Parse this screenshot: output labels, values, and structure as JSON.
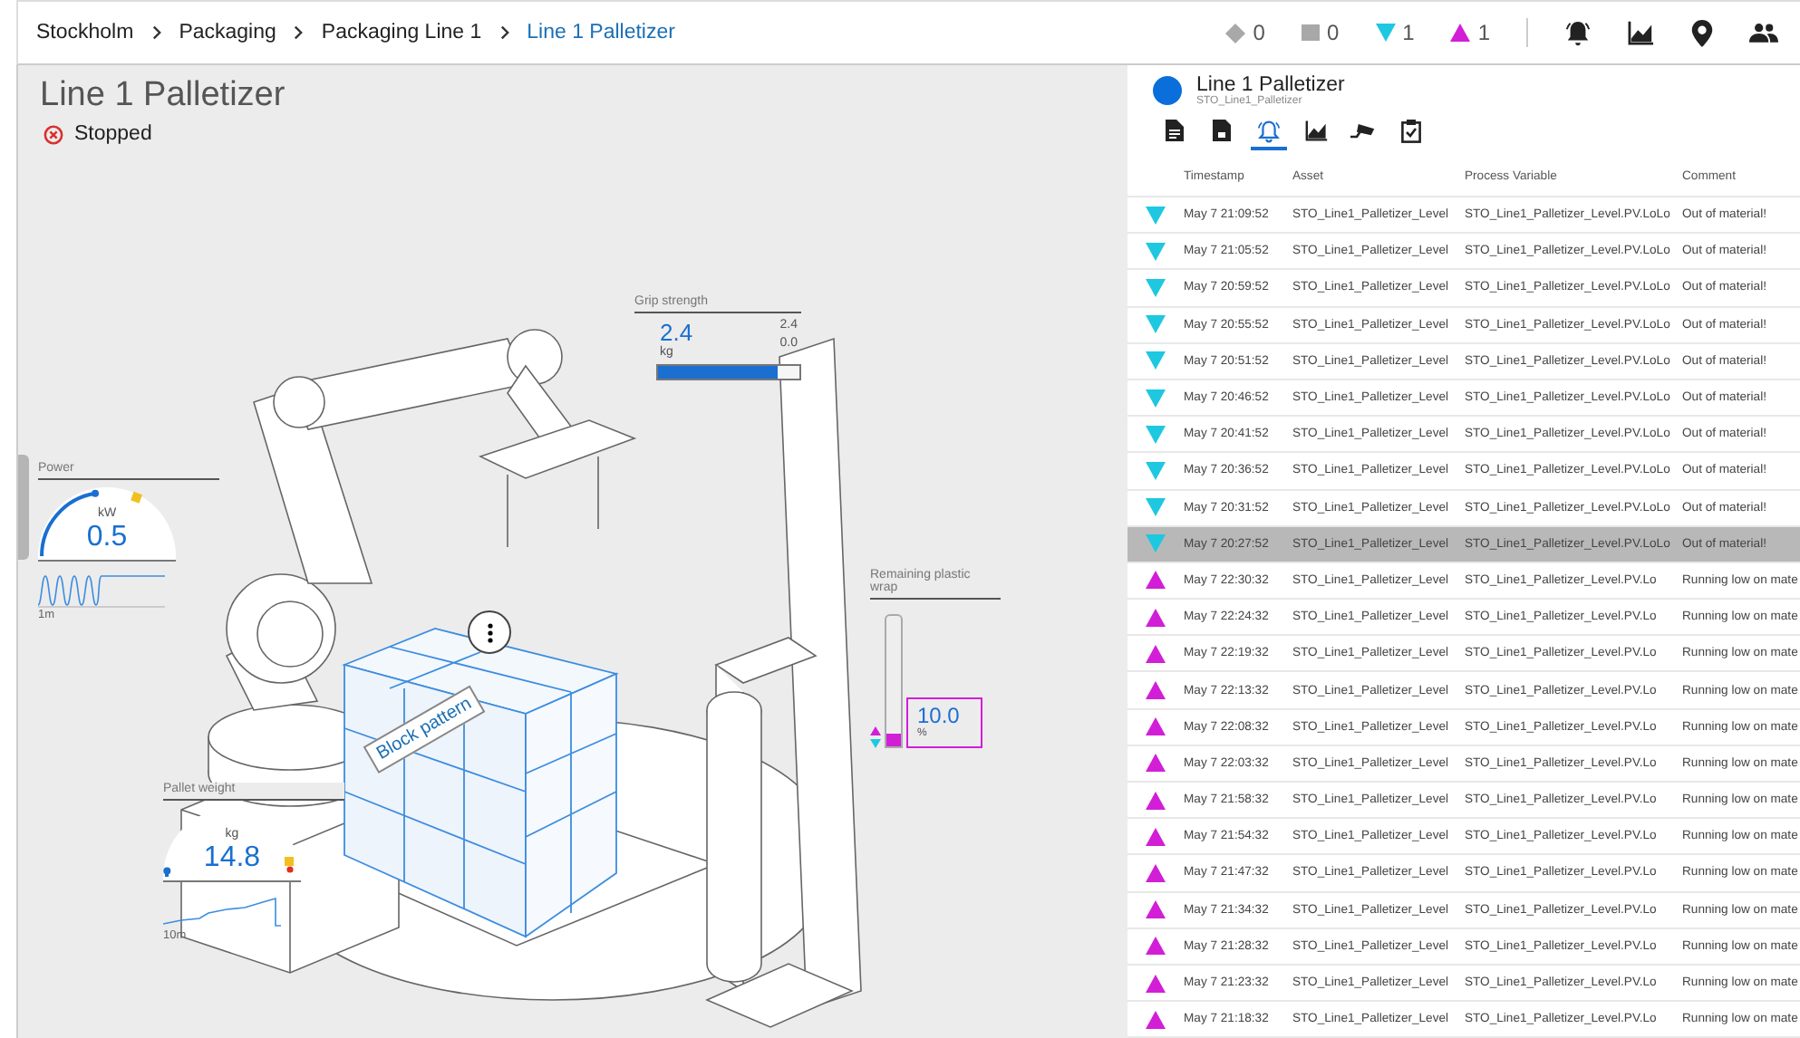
{
  "breadcrumb": [
    {
      "label": "Stockholm",
      "selected": false
    },
    {
      "label": "Packaging",
      "selected": false
    },
    {
      "label": "Packaging Line 1",
      "selected": false
    },
    {
      "label": "Line 1 Palletizer",
      "selected": true
    }
  ],
  "alarm_counts": [
    {
      "kind": "diamond",
      "count": "0"
    },
    {
      "kind": "square",
      "count": "0"
    },
    {
      "kind": "lolo",
      "count": "1"
    },
    {
      "kind": "lo",
      "count": "1"
    }
  ],
  "page": {
    "title": "Line 1 Palletizer",
    "status": "Stopped"
  },
  "widgets": {
    "power": {
      "label": "Power",
      "unit": "kW",
      "value": "0.5",
      "level": 0.45,
      "span": "1m"
    },
    "pallet_weight": {
      "label": "Pallet weight",
      "unit": "kg",
      "value": "14.8",
      "level": 0.03,
      "span": "10m"
    },
    "grip_strength": {
      "label": "Grip strength",
      "value": "2.4",
      "unit": "kg",
      "high": "2.4",
      "low": "0.0",
      "level": 0.85
    },
    "plastic_wrap": {
      "label": "Remaining plastic wrap",
      "value": "10.0",
      "unit": "%",
      "level": 0.1
    },
    "pallet_label": "Block pattern"
  },
  "panel": {
    "title": "Line 1 Palletizer",
    "subtitle": "STO_Line1_Palletizer",
    "tabs": [
      {
        "selected": false
      },
      {
        "selected": false
      },
      {
        "selected": true
      },
      {
        "selected": false
      },
      {
        "selected": false
      },
      {
        "selected": false
      }
    ],
    "columns": [
      "Timestamp",
      "Asset",
      "Process Variable",
      "Comment"
    ],
    "rows": [
      {
        "kind": "lolo",
        "selected": false,
        "timestamp": "May 7 21:09:52",
        "asset": "STO_Line1_Palletizer_Level",
        "variable": "STO_Line1_Palletizer_Level.PV.LoLo",
        "comment": "Out of material!"
      },
      {
        "kind": "lolo",
        "selected": false,
        "timestamp": "May 7 21:05:52",
        "asset": "STO_Line1_Palletizer_Level",
        "variable": "STO_Line1_Palletizer_Level.PV.LoLo",
        "comment": "Out of material!"
      },
      {
        "kind": "lolo",
        "selected": false,
        "timestamp": "May 7 20:59:52",
        "asset": "STO_Line1_Palletizer_Level",
        "variable": "STO_Line1_Palletizer_Level.PV.LoLo",
        "comment": "Out of material!"
      },
      {
        "kind": "lolo",
        "selected": false,
        "timestamp": "May 7 20:55:52",
        "asset": "STO_Line1_Palletizer_Level",
        "variable": "STO_Line1_Palletizer_Level.PV.LoLo",
        "comment": "Out of material!"
      },
      {
        "kind": "lolo",
        "selected": false,
        "timestamp": "May 7 20:51:52",
        "asset": "STO_Line1_Palletizer_Level",
        "variable": "STO_Line1_Palletizer_Level.PV.LoLo",
        "comment": "Out of material!"
      },
      {
        "kind": "lolo",
        "selected": false,
        "timestamp": "May 7 20:46:52",
        "asset": "STO_Line1_Palletizer_Level",
        "variable": "STO_Line1_Palletizer_Level.PV.LoLo",
        "comment": "Out of material!"
      },
      {
        "kind": "lolo",
        "selected": false,
        "timestamp": "May 7 20:41:52",
        "asset": "STO_Line1_Palletizer_Level",
        "variable": "STO_Line1_Palletizer_Level.PV.LoLo",
        "comment": "Out of material!"
      },
      {
        "kind": "lolo",
        "selected": false,
        "timestamp": "May 7 20:36:52",
        "asset": "STO_Line1_Palletizer_Level",
        "variable": "STO_Line1_Palletizer_Level.PV.LoLo",
        "comment": "Out of material!"
      },
      {
        "kind": "lolo",
        "selected": false,
        "timestamp": "May 7 20:31:52",
        "asset": "STO_Line1_Palletizer_Level",
        "variable": "STO_Line1_Palletizer_Level.PV.LoLo",
        "comment": "Out of material!"
      },
      {
        "kind": "lolo",
        "selected": true,
        "timestamp": "May 7 20:27:52",
        "asset": "STO_Line1_Palletizer_Level",
        "variable": "STO_Line1_Palletizer_Level.PV.LoLo",
        "comment": "Out of material!"
      },
      {
        "kind": "lo",
        "selected": false,
        "timestamp": "May 7 22:30:32",
        "asset": "STO_Line1_Palletizer_Level",
        "variable": "STO_Line1_Palletizer_Level.PV.Lo",
        "comment": "Running low on mate"
      },
      {
        "kind": "lo",
        "selected": false,
        "timestamp": "May 7 22:24:32",
        "asset": "STO_Line1_Palletizer_Level",
        "variable": "STO_Line1_Palletizer_Level.PV.Lo",
        "comment": "Running low on mate"
      },
      {
        "kind": "lo",
        "selected": false,
        "timestamp": "May 7 22:19:32",
        "asset": "STO_Line1_Palletizer_Level",
        "variable": "STO_Line1_Palletizer_Level.PV.Lo",
        "comment": "Running low on mate"
      },
      {
        "kind": "lo",
        "selected": false,
        "timestamp": "May 7 22:13:32",
        "asset": "STO_Line1_Palletizer_Level",
        "variable": "STO_Line1_Palletizer_Level.PV.Lo",
        "comment": "Running low on mate"
      },
      {
        "kind": "lo",
        "selected": false,
        "timestamp": "May 7 22:08:32",
        "asset": "STO_Line1_Palletizer_Level",
        "variable": "STO_Line1_Palletizer_Level.PV.Lo",
        "comment": "Running low on mate"
      },
      {
        "kind": "lo",
        "selected": false,
        "timestamp": "May 7 22:03:32",
        "asset": "STO_Line1_Palletizer_Level",
        "variable": "STO_Line1_Palletizer_Level.PV.Lo",
        "comment": "Running low on mate"
      },
      {
        "kind": "lo",
        "selected": false,
        "timestamp": "May 7 21:58:32",
        "asset": "STO_Line1_Palletizer_Level",
        "variable": "STO_Line1_Palletizer_Level.PV.Lo",
        "comment": "Running low on mate"
      },
      {
        "kind": "lo",
        "selected": false,
        "timestamp": "May 7 21:54:32",
        "asset": "STO_Line1_Palletizer_Level",
        "variable": "STO_Line1_Palletizer_Level.PV.Lo",
        "comment": "Running low on mate"
      },
      {
        "kind": "lo",
        "selected": false,
        "timestamp": "May 7 21:47:32",
        "asset": "STO_Line1_Palletizer_Level",
        "variable": "STO_Line1_Palletizer_Level.PV.Lo",
        "comment": "Running low on mate"
      },
      {
        "kind": "lo",
        "selected": false,
        "timestamp": "May 7 21:34:32",
        "asset": "STO_Line1_Palletizer_Level",
        "variable": "STO_Line1_Palletizer_Level.PV.Lo",
        "comment": "Running low on mate"
      },
      {
        "kind": "lo",
        "selected": false,
        "timestamp": "May 7 21:28:32",
        "asset": "STO_Line1_Palletizer_Level",
        "variable": "STO_Line1_Palletizer_Level.PV.Lo",
        "comment": "Running low on mate"
      },
      {
        "kind": "lo",
        "selected": false,
        "timestamp": "May 7 21:23:32",
        "asset": "STO_Line1_Palletizer_Level",
        "variable": "STO_Line1_Palletizer_Level.PV.Lo",
        "comment": "Running low on mate"
      },
      {
        "kind": "lo",
        "selected": false,
        "timestamp": "May 7 21:18:32",
        "asset": "STO_Line1_Palletizer_Level",
        "variable": "STO_Line1_Palletizer_Level.PV.Lo",
        "comment": "Running low on mate"
      }
    ]
  }
}
